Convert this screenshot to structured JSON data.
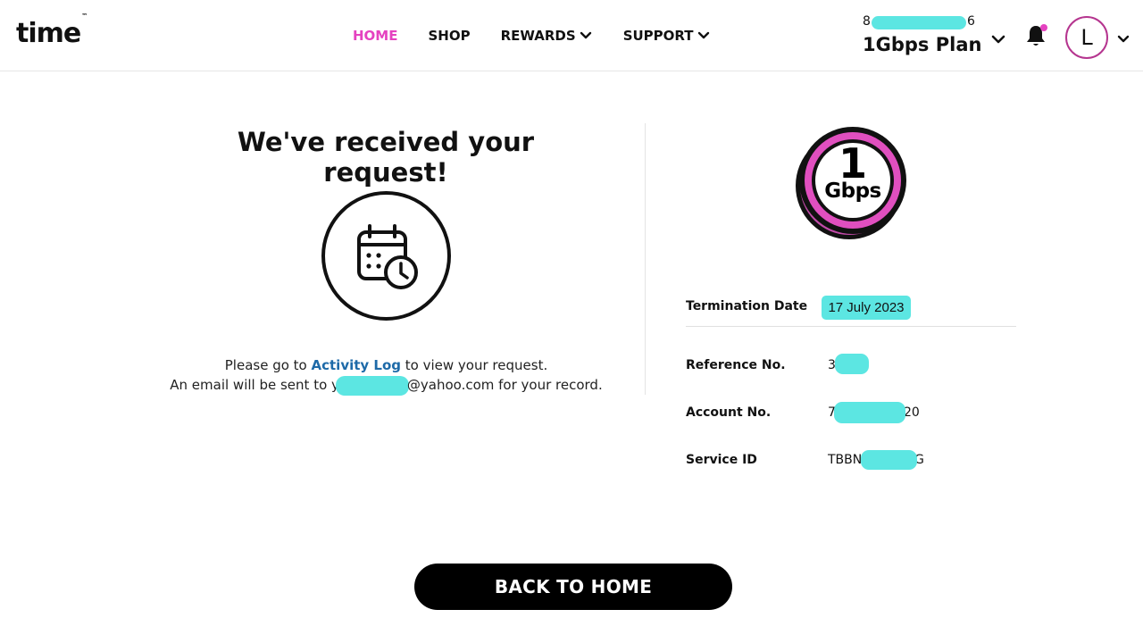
{
  "header": {
    "logo_text": "time",
    "logo_tm": "™",
    "nav": [
      {
        "label": "HOME",
        "active": true
      },
      {
        "label": "SHOP"
      },
      {
        "label": "REWARDS",
        "has_dropdown": true
      },
      {
        "label": "SUPPORT",
        "has_dropdown": true
      }
    ],
    "account_prefix": "8",
    "account_suffix": "6",
    "plan_name": "1Gbps Plan",
    "avatar_initial": "L",
    "icons": [
      "chevron-down-icon",
      "bell-icon",
      "notification-dot"
    ]
  },
  "main": {
    "heading": "We've received your request!",
    "icon": "calendar-clock-icon",
    "message_line1_before": "Please go to ",
    "message_link": "Activity Log",
    "message_line1_after": " to view your request.",
    "message_line2_before": "An email will be sent to y",
    "message_line2_after": "@yahoo.com for your record."
  },
  "plan_badge": {
    "number": "1",
    "unit": "Gbps"
  },
  "details": {
    "termination_label": "Termination Date",
    "termination_value": "17 July 2023",
    "reference_label": "Reference No.",
    "reference_value_visible": "3",
    "account_label": "Account No.",
    "account_value_prefix": "7",
    "account_value_suffix": "20",
    "service_label": "Service ID",
    "service_value_prefix": "TBBN",
    "service_value_suffix": "G"
  },
  "button": {
    "back_label": "BACK TO HOME"
  },
  "colors": {
    "accent_pink": "#e542c0",
    "redaction_cyan": "#5ce6e2",
    "link_blue": "#1e6aa8",
    "badge_pink": "#e04fbf"
  }
}
